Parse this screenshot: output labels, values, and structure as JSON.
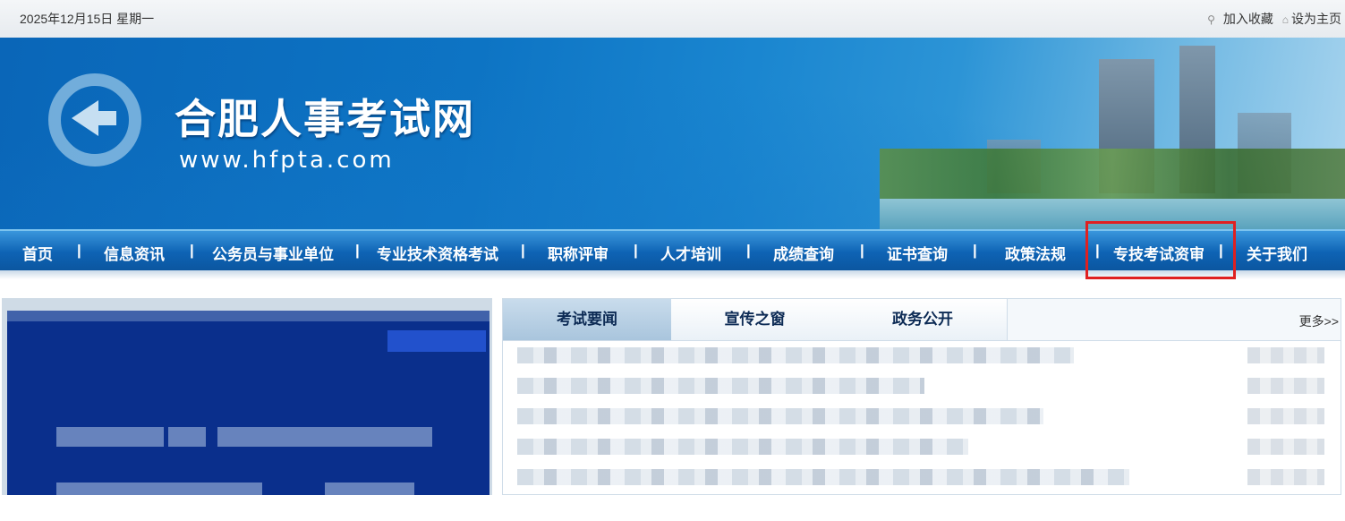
{
  "topbar": {
    "date": "2025年12月15日 星期一",
    "bookmark_label": "加入收藏",
    "homepage_label": "设为主页"
  },
  "header": {
    "site_title": "合肥人事考试网",
    "site_url": "www.hfpta.com"
  },
  "nav": {
    "items": [
      {
        "label": "首页"
      },
      {
        "label": "信息资讯"
      },
      {
        "label": "公务员与事业单位"
      },
      {
        "label": "专业技术资格考试"
      },
      {
        "label": "职称评审"
      },
      {
        "label": "人才培训"
      },
      {
        "label": "成绩查询"
      },
      {
        "label": "证书查询"
      },
      {
        "label": "政策法规"
      },
      {
        "label": "专技考试资审"
      },
      {
        "label": "关于我们"
      }
    ],
    "separator": "|"
  },
  "news": {
    "tabs": [
      {
        "label": "考试要闻"
      },
      {
        "label": "宣传之窗"
      },
      {
        "label": "政务公开"
      }
    ],
    "more_label": "更多>>"
  },
  "colors": {
    "nav_blue": "#0e63b4",
    "highlight_red": "#e02020",
    "slideshow_bg": "#0a2f8c"
  }
}
